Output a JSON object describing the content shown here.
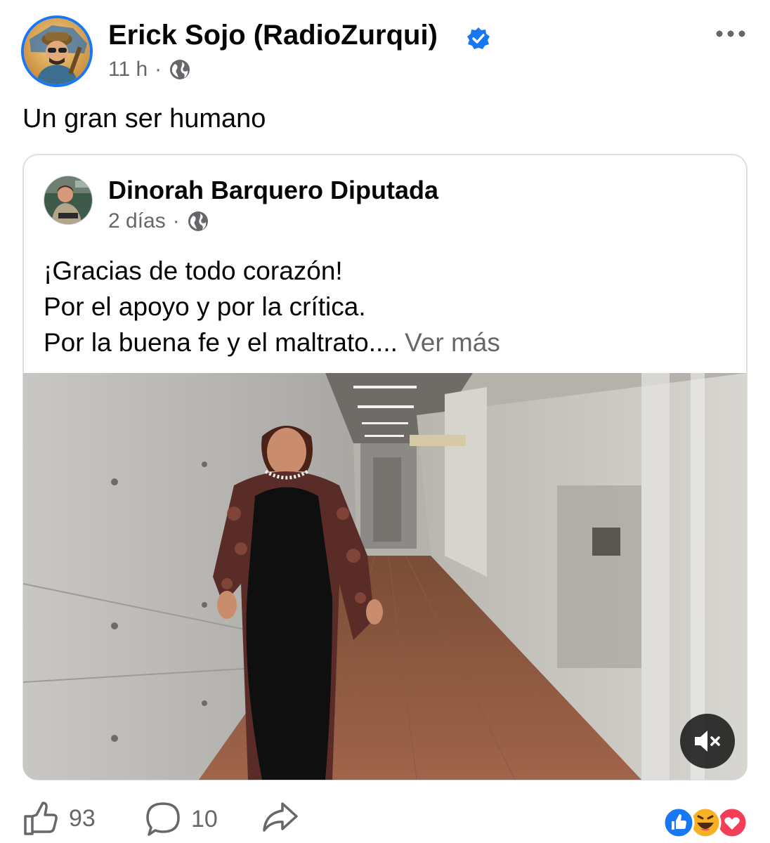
{
  "post": {
    "author": "Erick Sojo (RadioZurqui)",
    "time": "11 h",
    "separator": "·",
    "text": "Un gran ser humano"
  },
  "shared": {
    "author": "Dinorah Barquero Diputada",
    "time": "2 días",
    "separator": "·",
    "lines": [
      "¡Gracias de todo corazón!",
      "Por el apoyo y por la crítica.",
      "Por la buena fe y el maltrato...."
    ],
    "see_more": "Ver más"
  },
  "actions": {
    "likes": "93",
    "comments": "10"
  },
  "colors": {
    "verified": "#1877f2",
    "secondary_text": "#65676b",
    "like_reaction": "#1877f2",
    "love_reaction": "#f33e58",
    "haha_reaction": "#f7b125"
  },
  "icons": [
    "verified-badge-icon",
    "globe-icon",
    "more-options-icon",
    "mute-icon",
    "like-icon",
    "comment-icon",
    "share-icon",
    "like-reaction-icon",
    "haha-reaction-icon",
    "love-reaction-icon"
  ]
}
